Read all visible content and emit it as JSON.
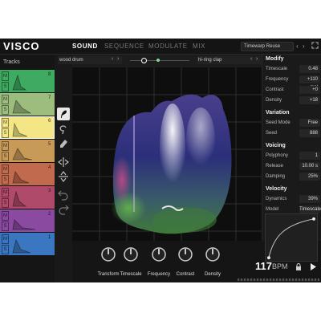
{
  "app": {
    "title": "VISCO"
  },
  "nav": {
    "tabs": [
      {
        "label": "SOUND",
        "active": true
      },
      {
        "label": "SEQUENCE",
        "active": false
      },
      {
        "label": "MODULATE",
        "active": false
      },
      {
        "label": "MIX",
        "active": false
      }
    ]
  },
  "preset": {
    "name": "Timewarp Reuse"
  },
  "tracks": {
    "label": "Tracks",
    "mute_label": "M",
    "solo_label": "S",
    "items": [
      {
        "num": "8",
        "color": "#3faa62",
        "active": false
      },
      {
        "num": "7",
        "color": "#9dbd7e",
        "active": false
      },
      {
        "num": "6",
        "color": "#f5e685",
        "active": true
      },
      {
        "num": "5",
        "color": "#c89a58",
        "active": false
      },
      {
        "num": "4",
        "color": "#c26a4e",
        "active": false
      },
      {
        "num": "3",
        "color": "#b04a6a",
        "active": false
      },
      {
        "num": "2",
        "color": "#8a4aa0",
        "active": false
      },
      {
        "num": "1",
        "color": "#3a77c0",
        "active": false
      }
    ]
  },
  "sound_a": {
    "name": "wood drum"
  },
  "sound_b": {
    "name": "hi-ring clap"
  },
  "blend": {
    "position": 0.25
  },
  "tools": [
    "brush-icon",
    "lasso-icon",
    "eraser-icon",
    "flip-horizontal-icon",
    "flip-vertical-icon",
    "undo-icon",
    "redo-icon"
  ],
  "panel": {
    "modify": {
      "title": "Modify",
      "rows": [
        {
          "label": "Timescale",
          "value": "0.48"
        },
        {
          "label": "Frequency",
          "value": "+110 mel"
        },
        {
          "label": "Contrast",
          "value": "+0"
        },
        {
          "label": "Density",
          "value": "+18"
        }
      ]
    },
    "variation": {
      "title": "Variation",
      "rows": [
        {
          "label": "Seed Mode",
          "value": "Free"
        },
        {
          "label": "Seed",
          "value": "888"
        }
      ]
    },
    "voicing": {
      "title": "Voicing",
      "rows": [
        {
          "label": "Polyphony",
          "value": "1"
        },
        {
          "label": "Release",
          "value": "10.00 s"
        },
        {
          "label": "Damping",
          "value": "25%"
        }
      ]
    },
    "velocity": {
      "title": "Velocity",
      "rows": [
        {
          "label": "Dynamics",
          "value": "39%"
        },
        {
          "label": "Model",
          "value": "Timescale"
        }
      ]
    }
  },
  "knobs": [
    {
      "label": "Transform"
    },
    {
      "label": "Timescale"
    },
    {
      "label": "Frequency"
    },
    {
      "label": "Contrast"
    },
    {
      "label": "Density"
    }
  ],
  "transport": {
    "bpm": "117",
    "unit": "BPM"
  },
  "colors": {
    "accent_green": "#7be08a",
    "active_track": "#f5e685"
  }
}
